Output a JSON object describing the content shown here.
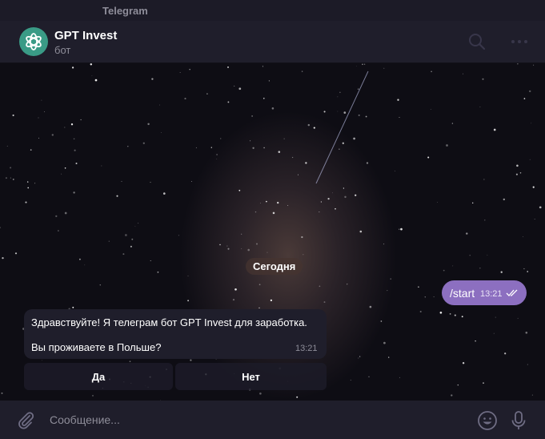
{
  "window": {
    "title": "Telegram"
  },
  "header": {
    "title": "GPT Invest",
    "subtitle": "бот"
  },
  "date_separator": "Сегодня",
  "outgoing_message": {
    "text": "/start",
    "time": "13:21"
  },
  "incoming_message": {
    "line1": "Здравствуйте! Я телеграм бот GPT Invest для заработка.",
    "line2": "Вы проживаете в Польше?",
    "time": "13:21"
  },
  "keyboard": {
    "yes_label": "Да",
    "no_label": "Нет"
  },
  "composer": {
    "placeholder": "Сообщение..."
  },
  "colors": {
    "accent": "#8c6fc0",
    "avatar": "#3a9b86",
    "icon": "#6f6d84"
  },
  "icons": [
    "openai-logo-icon",
    "search-icon",
    "more-icon",
    "paperclip-icon",
    "emoji-icon",
    "microphone-icon",
    "double-check-icon"
  ]
}
